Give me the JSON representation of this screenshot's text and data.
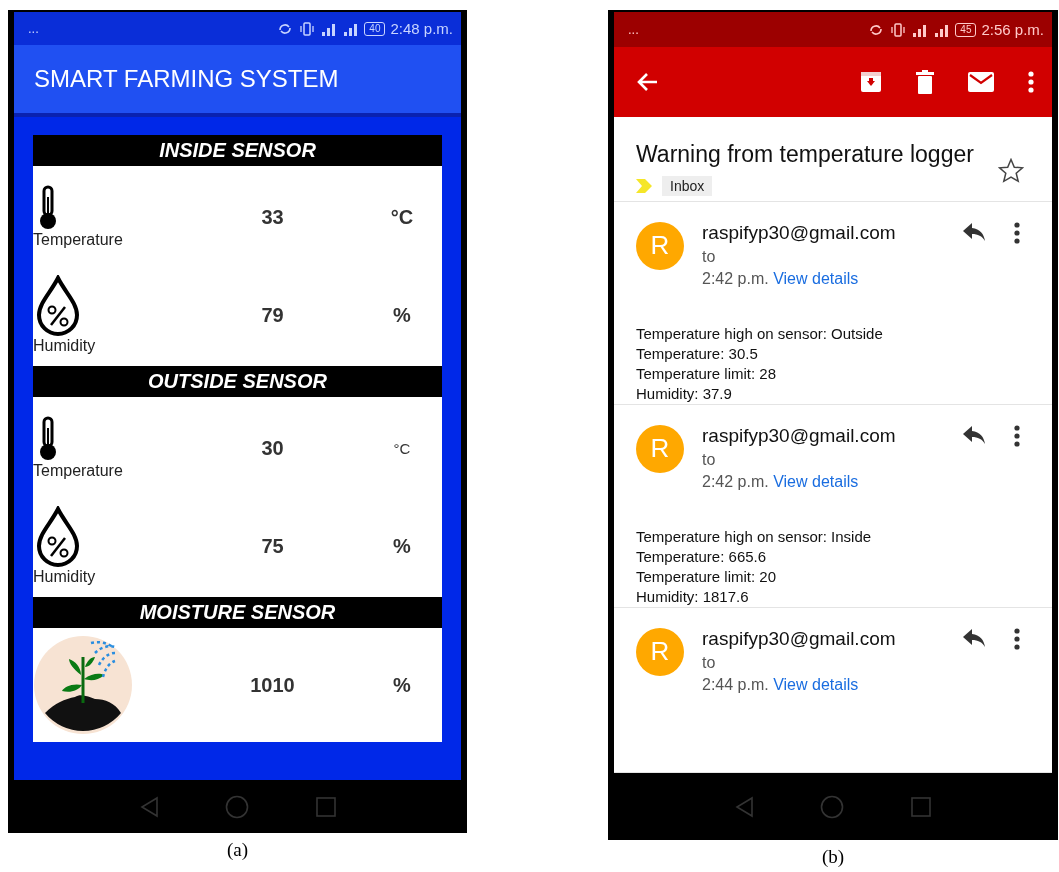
{
  "figure_a": {
    "status_bar": {
      "notifications": "...",
      "battery": "40",
      "time": "2:48 p.m."
    },
    "app_bar": {
      "title": "SMART FARMING SYSTEM"
    },
    "sensors": [
      {
        "title": "INSIDE SENSOR",
        "readings": [
          {
            "kind": "temperature",
            "label": "Temperature",
            "value": "33",
            "unit": "°C"
          },
          {
            "kind": "humidity",
            "label": "Humidity",
            "value": "79",
            "unit": "%"
          }
        ]
      },
      {
        "title": "OUTSIDE SENSOR",
        "readings": [
          {
            "kind": "temperature",
            "label": "Temperature",
            "value": "30",
            "unit": "°C"
          },
          {
            "kind": "humidity",
            "label": "Humidity",
            "value": "75",
            "unit": "%"
          }
        ]
      },
      {
        "title": "MOISTURE SENSOR",
        "readings": [
          {
            "kind": "moisture",
            "value": "1010",
            "unit": "%"
          }
        ]
      }
    ],
    "caption": "(a)"
  },
  "figure_b": {
    "status_bar": {
      "notifications": "...",
      "battery": "45",
      "time": "2:56 p.m."
    },
    "subject": "Warning from temperature logger",
    "label": "Inbox",
    "starred": false,
    "messages": [
      {
        "avatar": "R",
        "sender": "raspifyp30@gmail.com",
        "to": "to",
        "time": "2:42 p.m.",
        "details_link": "View details",
        "body": [
          "Temperature high on sensor: Outside",
          "Temperature: 30.5",
          "Temperature limit: 28",
          "Humidity: 37.9"
        ]
      },
      {
        "avatar": "R",
        "sender": "raspifyp30@gmail.com",
        "to": "to",
        "time": "2:42 p.m.",
        "details_link": "View details",
        "body": [
          "Temperature high on sensor: Inside",
          "Temperature: 665.6",
          "Temperature limit: 20",
          "Humidity: 1817.6"
        ]
      },
      {
        "avatar": "R",
        "sender": "raspifyp30@gmail.com",
        "to": "to",
        "time": "2:44 p.m.",
        "details_link": "View details"
      }
    ],
    "caption": "(b)"
  }
}
